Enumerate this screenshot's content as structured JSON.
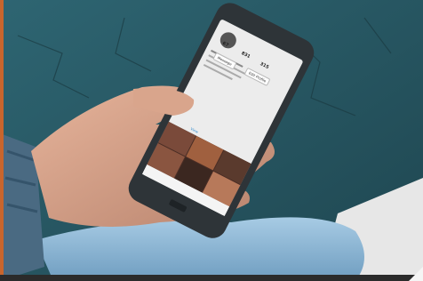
{
  "photo": {
    "subject": "phone-in-hand-instagram-profile",
    "colors": {
      "concrete": "#2a5662",
      "concrete_dark": "#1d3f49",
      "phone_body": "#2e3438",
      "phone_screen": "#ececec",
      "skin": "#d9a58c",
      "sleeve": "#4a6a82",
      "jeans": "#8cb7d6",
      "accent": "#c8652d"
    }
  },
  "phone": {
    "stats": {
      "posts": "67",
      "followers": "831",
      "following": "315"
    },
    "buttons": {
      "message": "Message",
      "follow": "Edit Profile"
    },
    "link_text": "View"
  }
}
